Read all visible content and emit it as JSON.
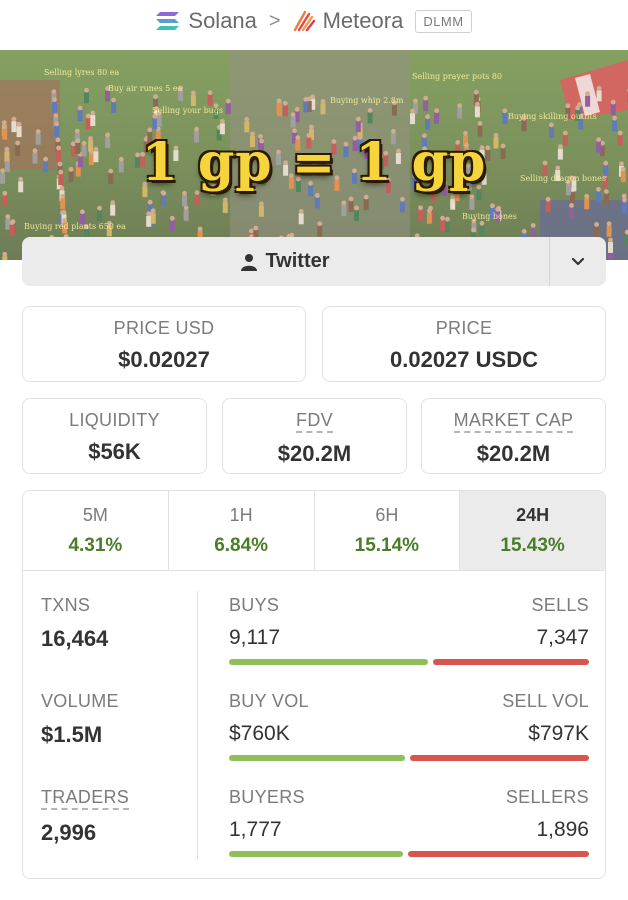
{
  "breadcrumb": {
    "chain": "Solana",
    "separator": ">",
    "dex": "Meteora",
    "badge": "DLMM"
  },
  "banner": {
    "headline": "1 gp = 1 gp",
    "notes": [
      "Selling lyres 80 ea",
      "Buy air runes 5 ea",
      "Selling your bugs",
      "Selling prayer pots 80",
      "Buying whip 2.8m",
      "Buying skilling outfits",
      "Selling dragon bones",
      "Buying bones",
      "Buying red plants 650 ea"
    ]
  },
  "social": {
    "label": "Twitter",
    "icon": "user-icon",
    "more_icon": "chevron-down-icon"
  },
  "price_cards": [
    {
      "label": "PRICE USD",
      "value": "$0.02027"
    },
    {
      "label": "PRICE",
      "value": "0.02027 USDC"
    }
  ],
  "metric_cards": [
    {
      "label": "LIQUIDITY",
      "value": "$56K",
      "dotted": false
    },
    {
      "label": "FDV",
      "value": "$20.2M",
      "dotted": true
    },
    {
      "label": "MARKET CAP",
      "value": "$20.2M",
      "dotted": true
    }
  ],
  "timeframes": [
    {
      "label": "5M",
      "change": "4.31%",
      "active": false
    },
    {
      "label": "1H",
      "change": "6.84%",
      "active": false
    },
    {
      "label": "6H",
      "change": "15.14%",
      "active": false
    },
    {
      "label": "24H",
      "change": "15.43%",
      "active": true
    }
  ],
  "stats": {
    "txns": {
      "label": "TXNS",
      "value": "16,464"
    },
    "volume": {
      "label": "VOLUME",
      "value": "$1.5M"
    },
    "traders": {
      "label": "TRADERS",
      "value": "2,996"
    },
    "buys": {
      "label": "BUYS",
      "value": "9,117",
      "label_right": "SELLS",
      "value_right": "7,347",
      "buy_share": 0.554
    },
    "buy_vol": {
      "label": "BUY VOL",
      "value": "$760K",
      "label_right": "SELL VOL",
      "value_right": "$797K",
      "buy_share": 0.488
    },
    "buyers": {
      "label": "BUYERS",
      "value": "1,777",
      "label_right": "SELLERS",
      "value_right": "1,896",
      "buy_share": 0.484
    }
  },
  "colors": {
    "positive": "#4a7d2a",
    "buy_bar": "#8fbf5a",
    "sell_bar": "#d9534f",
    "headline": "#f6d53c"
  }
}
